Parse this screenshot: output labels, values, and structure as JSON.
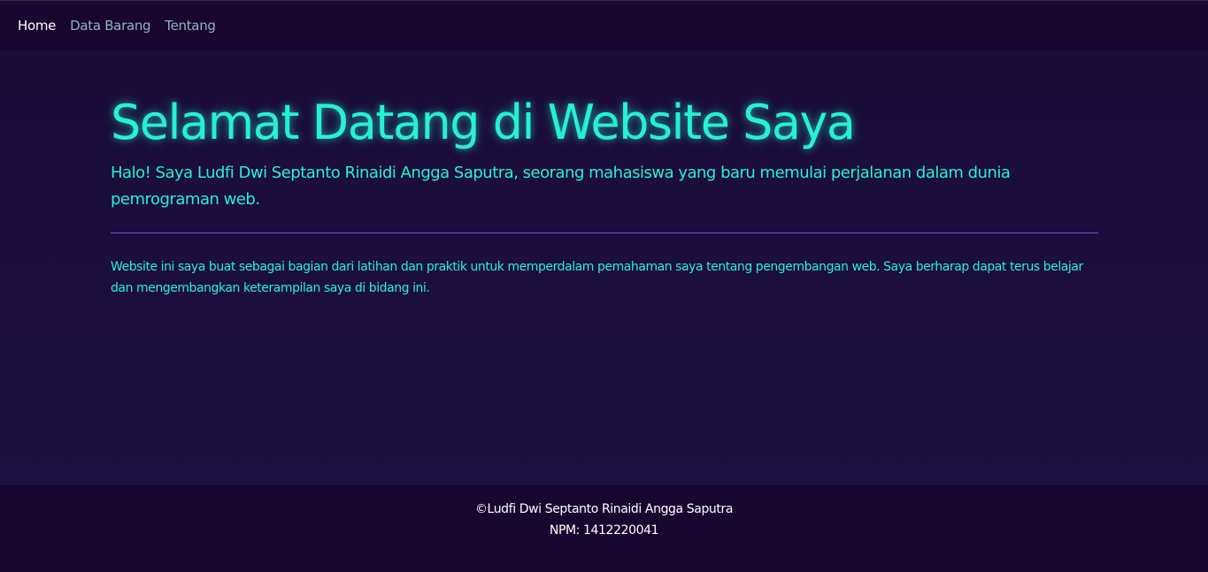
{
  "nav": {
    "items": [
      {
        "label": "Home",
        "active": true
      },
      {
        "label": "Data Barang",
        "active": false
      },
      {
        "label": "Tentang",
        "active": false
      }
    ]
  },
  "hero": {
    "title": "Selamat Datang di Website Saya",
    "lead": "Halo! Saya Ludfi Dwi Septanto Rinaidi Angga Saputra, seorang mahasiswa yang baru memulai perjalanan dalam dunia pemrograman web.",
    "body": "Website ini saya buat sebagai bagian dari latihan dan praktik untuk memperdalam pemahaman saya tentang pengembangan web. Saya berharap dapat terus belajar dan mengembangkan keterampilan saya di bidang ini."
  },
  "footer": {
    "copyright": "©Ludfi Dwi Septanto Rinaidi Angga Saputra",
    "npm": "NPM: 1412220041"
  },
  "colors": {
    "accent": "#26f0d6",
    "nav_bg": "#180530",
    "main_bg": "#1b0c3a",
    "divider": "#7a44d8",
    "nav_inactive": "#8fb3bc"
  }
}
